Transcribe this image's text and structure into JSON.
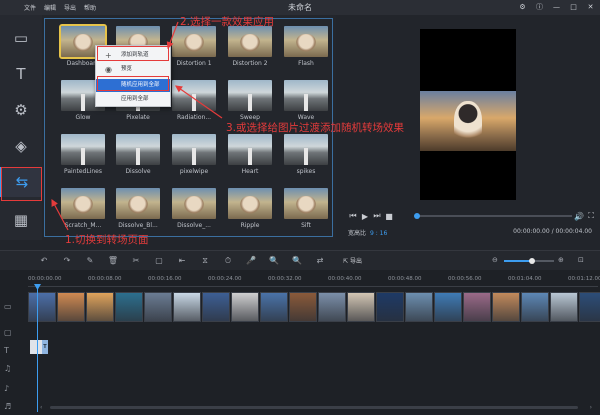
{
  "window": {
    "title": "未命名",
    "menu": [
      "文件",
      "编辑",
      "导出",
      "帮助"
    ],
    "controls": [
      "⚙",
      "ⓘ",
      "—",
      "□",
      "✕"
    ]
  },
  "sidebar": {
    "items": [
      {
        "name": "media",
        "icon": "video-frame-icon",
        "glyph": "▭"
      },
      {
        "name": "text",
        "icon": "text-icon",
        "glyph": "T"
      },
      {
        "name": "filters",
        "icon": "filter-icon",
        "glyph": "⚙"
      },
      {
        "name": "overlays",
        "icon": "layers-icon",
        "glyph": "◈"
      },
      {
        "name": "transitions",
        "icon": "transition-icon",
        "glyph": "⇆",
        "active": true
      },
      {
        "name": "elements",
        "icon": "film-icon",
        "glyph": "▦"
      }
    ]
  },
  "transitions": {
    "items": [
      {
        "label": "Dashboard",
        "type": "dog",
        "selected": true
      },
      {
        "label": "",
        "type": "dog"
      },
      {
        "label": "Distortion 1",
        "type": "dog"
      },
      {
        "label": "Distortion 2",
        "type": "dog"
      },
      {
        "label": "Flash",
        "type": "dog"
      },
      {
        "label": "Glow",
        "type": "road"
      },
      {
        "label": "Pixelate",
        "type": "road"
      },
      {
        "label": "Radiation...",
        "type": "road"
      },
      {
        "label": "Sweep",
        "type": "road"
      },
      {
        "label": "Wave",
        "type": "road"
      },
      {
        "label": "PaintedLines",
        "type": "road"
      },
      {
        "label": "Dissolve",
        "type": "road"
      },
      {
        "label": "pixelwipe",
        "type": "road"
      },
      {
        "label": "Heart",
        "type": "road"
      },
      {
        "label": "spikes",
        "type": "road"
      },
      {
        "label": "Scratch_M...",
        "type": "dog"
      },
      {
        "label": "Dissolve_Bl...",
        "type": "dog"
      },
      {
        "label": "Dissolve_...",
        "type": "dog"
      },
      {
        "label": "Ripple",
        "type": "dog"
      },
      {
        "label": "Sift",
        "type": "dog"
      }
    ]
  },
  "context_menu": {
    "items": [
      {
        "label": "添加到轨道",
        "icon": "plus-icon",
        "glyph": "+"
      },
      {
        "label": "预览",
        "icon": "eye-icon",
        "glyph": "◉"
      },
      {
        "label": "随机应用到全部",
        "highlighted": true
      },
      {
        "label": "应用到全部"
      }
    ]
  },
  "annotations": {
    "step1": "1.切换到转场页面",
    "step2": "2.选择一款效果应用",
    "step3": "3.或选择给图片过渡添加随机转场效果"
  },
  "player": {
    "aspect_label": "宽高比",
    "aspect_value": "9 : 16",
    "timecode": "00:00:00.00 / 00:00:04.00",
    "progress": 0.0,
    "controls": [
      "⏮",
      "▶",
      "⏭",
      "■"
    ],
    "right_controls": [
      "🔊",
      "⛶"
    ]
  },
  "toolbar": {
    "export_label": "导出",
    "tools": [
      "↶",
      "↷",
      "✎",
      "🗑",
      "✂",
      "▢",
      "⇤",
      "⧖",
      "⏱",
      "🎤",
      "🔍",
      "🔍",
      "⇄"
    ],
    "zoom_level": 0.56
  },
  "timeline": {
    "ticks": [
      "00:00:00.00",
      "00:00:08.00",
      "00:00:16.00",
      "00:00:24.00",
      "00:00:32.00",
      "00:00:40.00",
      "00:00:48.00",
      "00:00:56.00",
      "00:01:04.00",
      "00:01:12.00"
    ],
    "text_clip": "T",
    "clip_colors": [
      "#4c6fa8",
      "#d08a52",
      "#e0a35c",
      "#2c6f8e",
      "#6b7c93",
      "#c9d8e6",
      "#3d5f94",
      "#cfcfd0",
      "#4a73a8",
      "#8a5a3a",
      "#7b8fa9",
      "#d3c6b4",
      "#1e3a66",
      "#6d8fb0",
      "#3f7bb5",
      "#9a6a88",
      "#c28a5c",
      "#5d87b5",
      "#b9c7d4",
      "#2c4d78"
    ]
  },
  "colors": {
    "accent": "#3d9df0",
    "annotation": "#e53b3b",
    "selection": "#e6c34a",
    "menu_highlight": "#2d6fd3"
  }
}
